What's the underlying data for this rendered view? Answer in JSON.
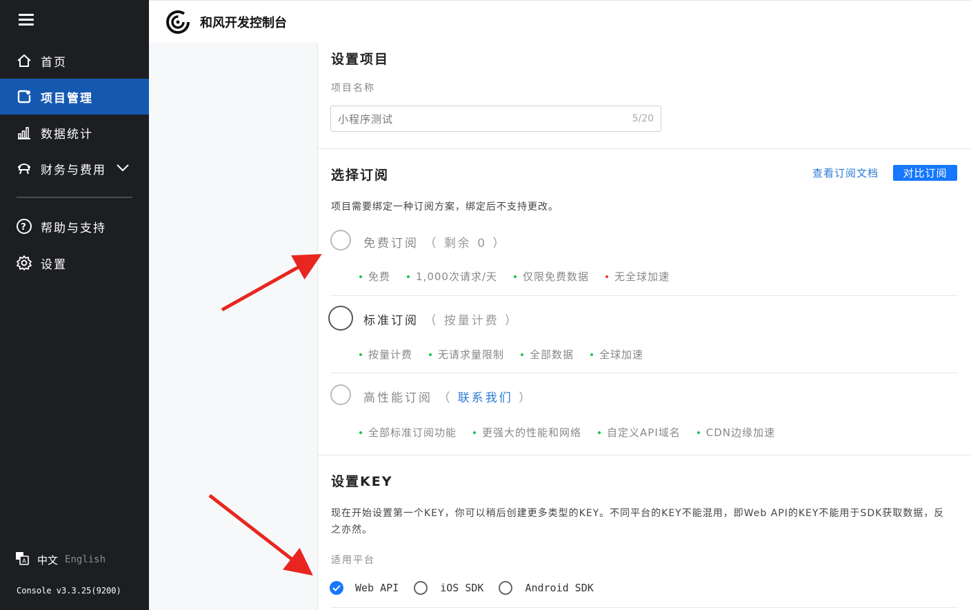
{
  "sidebar": {
    "items": [
      {
        "label": "首页",
        "icon": "home-icon"
      },
      {
        "label": "项目管理",
        "icon": "project-icon",
        "active": true
      },
      {
        "label": "数据统计",
        "icon": "bar-chart-icon"
      },
      {
        "label": "财务与费用",
        "icon": "finance-icon"
      },
      {
        "label": "帮助与支持",
        "icon": "help-icon"
      },
      {
        "label": "设置",
        "icon": "gear-icon"
      }
    ],
    "lang_zh": "中文",
    "lang_en": "English",
    "version": "Console v3.3.25(9200)"
  },
  "header": {
    "title": "和风开发控制台"
  },
  "project": {
    "title": "设置项目",
    "name_label": "项目名称",
    "name_value": "小程序测试",
    "name_count": "5/20"
  },
  "subscription": {
    "title": "选择订阅",
    "docs_link": "查看订阅文档",
    "compare_button": "对比订阅",
    "description": "项目需要绑定一种订阅方案，绑定后不支持更改。",
    "plans": [
      {
        "name": "免费订阅",
        "paren_open": "（",
        "note": "剩余 0",
        "paren_close": "）",
        "features": [
          "免费",
          "1,000次请求/天",
          "仅限免费数据",
          "无全球加速"
        ]
      },
      {
        "name": "标准订阅",
        "paren_open": "（",
        "note": "按量计费",
        "paren_close": "）",
        "features": [
          "按量计费",
          "无请求量限制",
          "全部数据",
          "全球加速"
        ]
      },
      {
        "name": "高性能订阅",
        "paren_open": "（",
        "note": "联系我们",
        "paren_close": "）",
        "features": [
          "全部标准订阅功能",
          "更强大的性能和网络",
          "自定义API域名",
          "CDN边缘加速"
        ]
      }
    ]
  },
  "key": {
    "title": "设置KEY",
    "description": "现在开始设置第一个KEY，你可以稍后创建更多类型的KEY。不同平台的KEY不能混用，即Web API的KEY不能用于SDK获取数据，反之亦然。",
    "platform_label": "适用平台",
    "platforms": [
      "Web API",
      "iOS SDK",
      "Android SDK"
    ],
    "selected_platform": "Web API"
  },
  "colors": {
    "sidebar_bg": "#1c1e21",
    "active_nav": "#1558b0",
    "primary": "#1677ff",
    "link": "#2a7bd6",
    "feature_dot": "#19c34a",
    "negative_dot": "#e53935",
    "annotation_arrow": "#e8261f"
  }
}
